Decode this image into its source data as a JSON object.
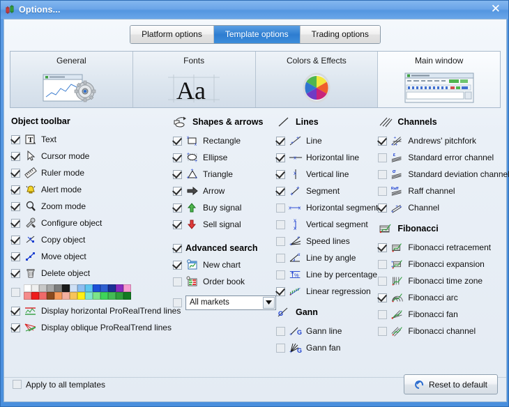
{
  "window": {
    "title": "Options...",
    "icon": "candlestick-icon",
    "close_label": "✕"
  },
  "top_tabs": [
    {
      "label": "Platform options",
      "selected": false
    },
    {
      "label": "Template options",
      "selected": true
    },
    {
      "label": "Trading options",
      "selected": false
    }
  ],
  "categories": [
    {
      "label": "General",
      "icon": "window-gear-icon",
      "active": false
    },
    {
      "label": "Fonts",
      "icon": "font-aa-icon",
      "active": false
    },
    {
      "label": "Colors & Effects",
      "icon": "color-wheel-icon",
      "active": false
    },
    {
      "label": "Main window",
      "icon": "main-window-preview-icon",
      "active": true
    }
  ],
  "groups": {
    "object_toolbar": {
      "title": "Object toolbar",
      "items": [
        {
          "label": "Text",
          "checked": true,
          "icon": "text-tool-icon"
        },
        {
          "label": "Cursor mode",
          "checked": true,
          "icon": "cursor-arrow-icon"
        },
        {
          "label": "Ruler mode",
          "checked": true,
          "icon": "ruler-icon"
        },
        {
          "label": "Alert mode",
          "checked": true,
          "icon": "bell-icon"
        },
        {
          "label": "Zoom mode",
          "checked": true,
          "icon": "magnifier-icon"
        },
        {
          "label": "Configure object",
          "checked": true,
          "icon": "tools-icon"
        },
        {
          "label": "Copy object",
          "checked": true,
          "icon": "copy-object-icon"
        },
        {
          "label": "Move object",
          "checked": true,
          "icon": "move-object-icon"
        },
        {
          "label": "Delete object",
          "checked": true,
          "icon": "trash-icon"
        }
      ],
      "palette_row": {
        "checked": false,
        "name": "color-palette",
        "colors_row1": [
          "#ffffff",
          "#efefef",
          "#c8c8c8",
          "#a8a8a8",
          "#7d7d7d",
          "#1a1a1a",
          "#cfe0f5",
          "#8dbdf0",
          "#5fc6f0",
          "#1c4fd8",
          "#2f5fd0",
          "#1b2f96",
          "#8a2bc0",
          "#f79bd0"
        ],
        "colors_row2": [
          "#f58b8b",
          "#ee1c1c",
          "#f06a6a",
          "#8a4a1e",
          "#f59a5a",
          "#f4b0a0",
          "#f7c45a",
          "#ffef14",
          "#7fe6cf",
          "#7ce58a",
          "#3fd45a",
          "#44bb55",
          "#2f9e3c",
          "#137a22"
        ]
      },
      "trend_items": [
        {
          "label": "Display horizontal ProRealTrend lines",
          "checked": true,
          "icon": "horizontal-trend-icon"
        },
        {
          "label": "Display oblique ProRealTrend lines",
          "checked": true,
          "icon": "oblique-trend-icon"
        }
      ]
    },
    "shapes_arrows": {
      "title": "Shapes & arrows",
      "icon": "shapes-arrows-icon",
      "items": [
        {
          "label": "Rectangle",
          "checked": true,
          "icon": "rectangle-icon"
        },
        {
          "label": "Ellipse",
          "checked": true,
          "icon": "ellipse-icon"
        },
        {
          "label": "Triangle",
          "checked": true,
          "icon": "triangle-icon"
        },
        {
          "label": "Arrow",
          "checked": true,
          "icon": "arrow-icon"
        },
        {
          "label": "Buy signal",
          "checked": true,
          "icon": "buy-arrow-up-icon"
        },
        {
          "label": "Sell signal",
          "checked": true,
          "icon": "sell-arrow-down-icon"
        }
      ]
    },
    "advanced_search": {
      "title": "Advanced search",
      "checked": true,
      "items": [
        {
          "label": "New chart",
          "checked": true,
          "icon": "new-chart-icon"
        },
        {
          "label": "Order book",
          "checked": false,
          "icon": "order-book-icon"
        }
      ],
      "market_select": {
        "checked": false,
        "value": "All markets",
        "options": [
          "All markets"
        ]
      }
    },
    "lines": {
      "title": "Lines",
      "icon": "line-icon",
      "items": [
        {
          "label": "Line",
          "checked": true,
          "icon": "line-icon"
        },
        {
          "label": "Horizontal line",
          "checked": true,
          "icon": "horizontal-line-icon"
        },
        {
          "label": "Vertical line",
          "checked": true,
          "icon": "vertical-line-icon"
        },
        {
          "label": "Segment",
          "checked": true,
          "icon": "segment-icon"
        },
        {
          "label": "Horizontal segment",
          "checked": false,
          "icon": "horizontal-segment-icon"
        },
        {
          "label": "Vertical segment",
          "checked": false,
          "icon": "vertical-segment-icon"
        },
        {
          "label": "Speed lines",
          "checked": false,
          "icon": "speed-lines-icon"
        },
        {
          "label": "Line by angle",
          "checked": false,
          "icon": "line-by-angle-icon"
        },
        {
          "label": "Line by percentage",
          "checked": false,
          "icon": "line-by-percentage-icon"
        },
        {
          "label": "Linear regression",
          "checked": true,
          "icon": "linear-regression-icon"
        }
      ]
    },
    "gann": {
      "title": "Gann",
      "icon": "gann-icon",
      "items": [
        {
          "label": "Gann line",
          "checked": false,
          "icon": "gann-line-icon"
        },
        {
          "label": "Gann fan",
          "checked": false,
          "icon": "gann-fan-icon"
        }
      ]
    },
    "channels": {
      "title": "Channels",
      "icon": "channels-icon",
      "items": [
        {
          "label": "Andrews' pitchfork",
          "checked": true,
          "icon": "pitchfork-icon"
        },
        {
          "label": "Standard error channel",
          "checked": false,
          "icon": "std-error-channel-icon"
        },
        {
          "label": "Standard deviation channel",
          "checked": false,
          "icon": "std-deviation-channel-icon"
        },
        {
          "label": "Raff channel",
          "checked": false,
          "icon": "raff-channel-icon"
        },
        {
          "label": "Channel",
          "checked": true,
          "icon": "channel-icon"
        }
      ]
    },
    "fibonacci": {
      "title": "Fibonacci",
      "icon": "fibonacci-icon",
      "items": [
        {
          "label": "Fibonacci retracement",
          "checked": true,
          "icon": "fib-retracement-icon"
        },
        {
          "label": "Fibonacci expansion",
          "checked": false,
          "icon": "fib-expansion-icon"
        },
        {
          "label": "Fibonacci time zone",
          "checked": false,
          "icon": "fib-time-zone-icon"
        },
        {
          "label": "Fibonacci arc",
          "checked": true,
          "icon": "fib-arc-icon"
        },
        {
          "label": "Fibonacci fan",
          "checked": false,
          "icon": "fib-fan-icon"
        },
        {
          "label": "Fibonacci channel",
          "checked": false,
          "icon": "fib-channel-icon"
        }
      ]
    }
  },
  "footer": {
    "apply_all_label": "Apply to all templates",
    "apply_all_checked": false,
    "reset_label": "Reset to default",
    "reset_icon": "undo-arrow-icon"
  },
  "colors": {
    "titlebar_blue": "#5496e0",
    "tab_selected": "#2f7ed1",
    "panel_bg": "#e4ebf3",
    "accent_blue": "#1c3fd0",
    "buy_green": "#2f9e3c",
    "sell_red": "#d81f1f"
  }
}
